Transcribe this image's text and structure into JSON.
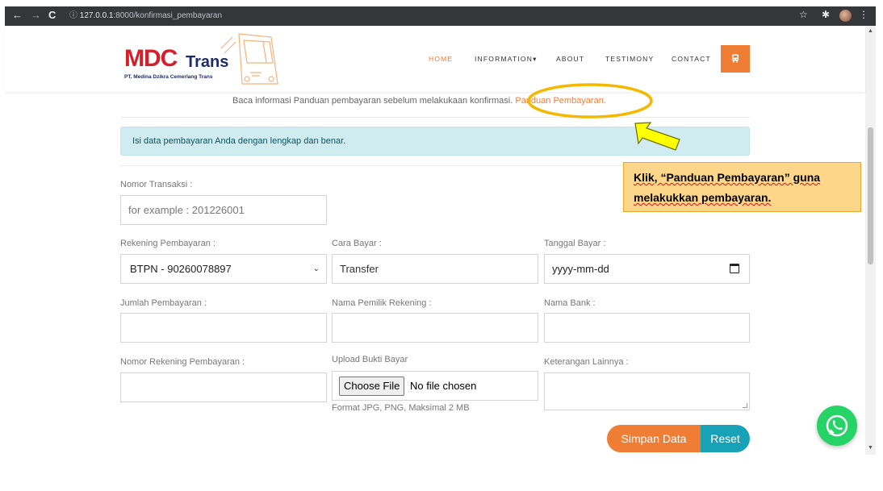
{
  "browser": {
    "back": "←",
    "forward": "→",
    "reload": "C",
    "info_icon": "ⓘ",
    "url_host": "127.0.0.1",
    "url_path": ":8000/konfirmasi_pembayaran",
    "star": "☆",
    "ext": "✱",
    "more": "⋮"
  },
  "header": {
    "logo_main": "MDC",
    "logo_sub": "Trans",
    "logo_tagline": "PT. Medina Dzikra Cemerlang Trans",
    "menu": [
      "HOME",
      "INFORMATION",
      "ABOUT",
      "TESTIMONY",
      "CONTACT"
    ],
    "menu_caret": "▾",
    "button_icon": "bus-icon",
    "accent_color": "#f07d34"
  },
  "info": {
    "text": "Baca informasi Panduan pembayaran sebelum melakukaan konfirmasi.",
    "link": "Panduan Pembayaran."
  },
  "alert": {
    "text": "Isi data pembayaran Anda dengan lengkap dan benar."
  },
  "form": {
    "nomor_transaksi_label": "Nomor Transaksi :",
    "nomor_transaksi_placeholder": "for example : 201226001",
    "rekening_label": "Rekening Pembayaran :",
    "rekening_value": "BTPN - 90260078897",
    "cara_bayar_label": "Cara Bayar :",
    "cara_bayar_value": "Transfer",
    "tanggal_label": "Tanggal Bayar :",
    "tanggal_placeholder": "yyyy-mm-dd",
    "jumlah_label": "Jumlah Pembayaran :",
    "nama_pemilik_label": "Nama Pemilik Rekening :",
    "nama_bank_label": "Nama Bank :",
    "nomor_rekening_label": "Nomor Rekening Pembayaran :",
    "upload_label": "Upload Bukti Bayar",
    "upload_button": "Choose File",
    "upload_status": "No file chosen",
    "upload_hint": "Format JPG, PNG, Maksimal 2 MB",
    "keterangan_label": "Keterangan Lainnya :",
    "save_button": "Simpan Data",
    "reset_button": "Reset"
  },
  "annotation": {
    "line1": "Klik, “Panduan Pembayaran” guna",
    "line2": "melakukkan pembayaran."
  }
}
